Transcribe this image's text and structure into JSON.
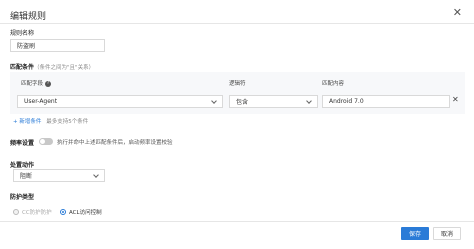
{
  "dialog": {
    "title": "编辑规则",
    "close_icon": "close-icon"
  },
  "rule_name": {
    "label": "规则名称",
    "value": "防盗刷"
  },
  "match": {
    "label": "匹配条件",
    "hint": "（条件之间为\"且\"关系）",
    "col_field": "匹配字段",
    "col_logic": "逻辑符",
    "col_content": "匹配内容",
    "field_value": "User-Agent",
    "logic_value": "包含",
    "content_value": "Android 7.0",
    "add_condition": "+ 新增条件",
    "add_hint": "最多支持5个条件"
  },
  "frequency": {
    "label": "频率设置",
    "desc": "执行并命中上述匹配条件后，启动频率设置校验",
    "enabled": false
  },
  "action": {
    "label": "处置动作",
    "value": "阻断"
  },
  "protect": {
    "label": "防护类型",
    "option_cc": "CC防护防护",
    "option_acl": "ACL访问控制",
    "selected": "acl"
  },
  "footer": {
    "save_label": "保存",
    "cancel_label": "取消"
  },
  "colors": {
    "accent": "#2a7bd7"
  }
}
